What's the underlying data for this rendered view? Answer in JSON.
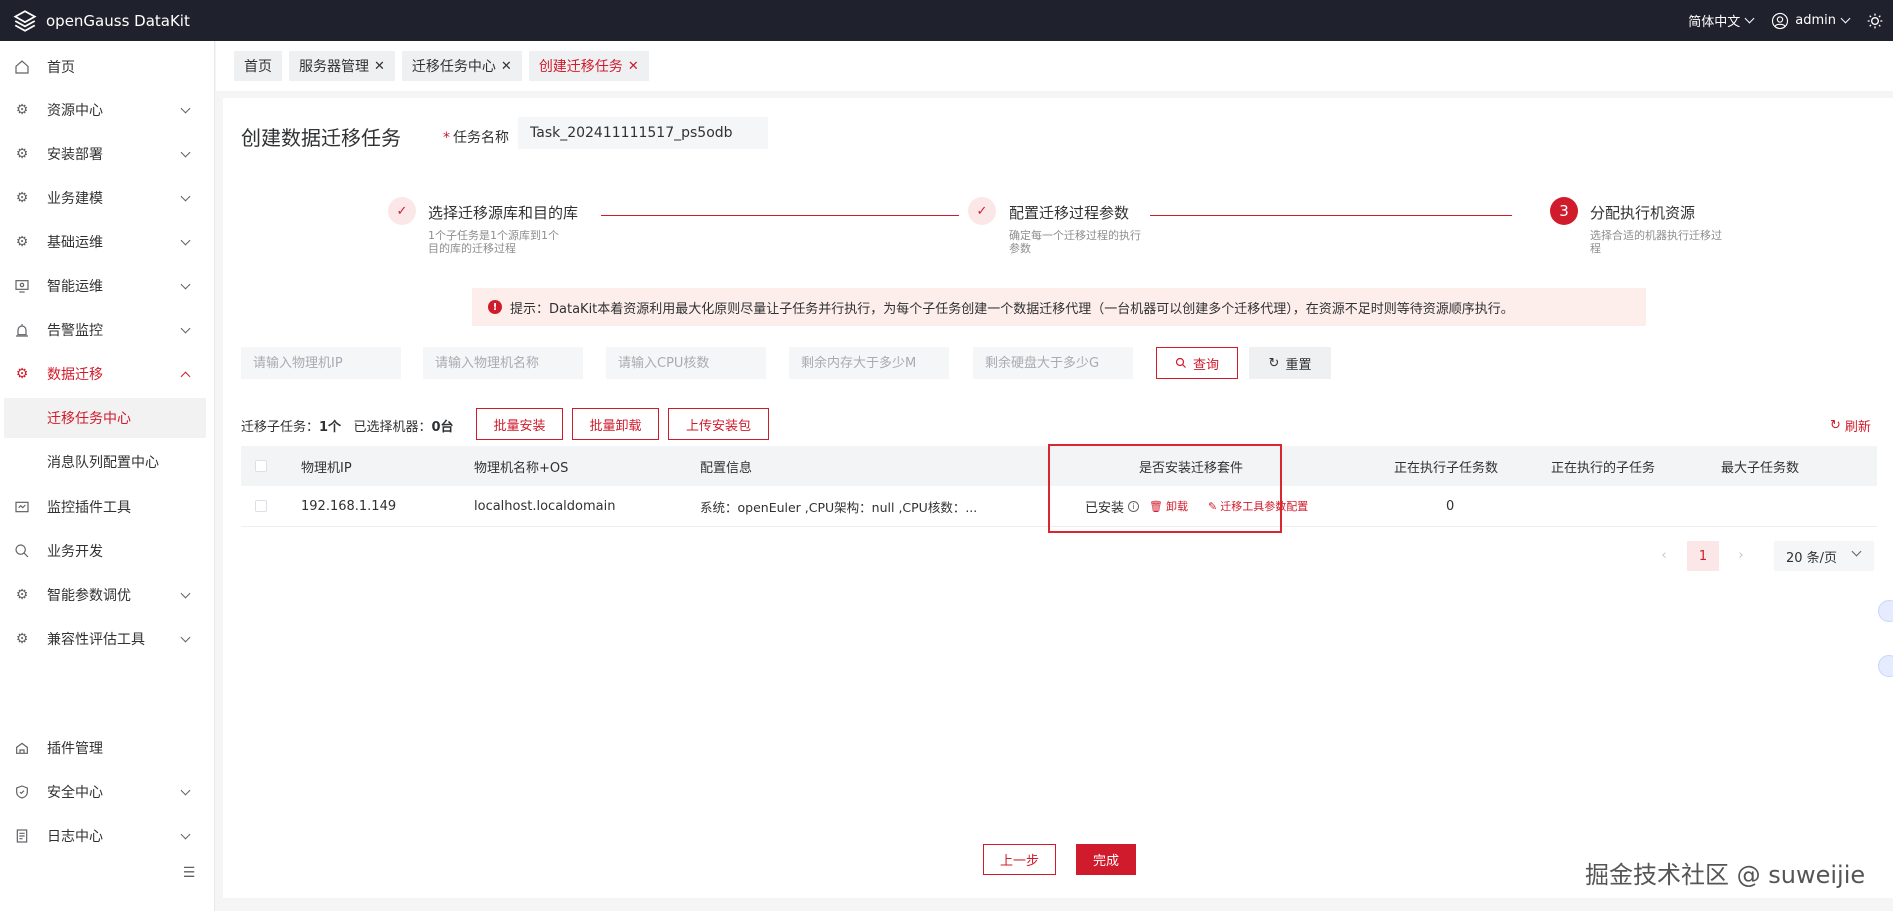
{
  "app": {
    "title": "openGauss DataKit"
  },
  "topbar": {
    "language": "简体中文",
    "user": "admin"
  },
  "sidebar": {
    "items": [
      {
        "label": "首页",
        "icon": "home-icon",
        "expandable": false
      },
      {
        "label": "资源中心",
        "icon": "gear-icon",
        "expandable": true
      },
      {
        "label": "安装部署",
        "icon": "gear-icon",
        "expandable": true
      },
      {
        "label": "业务建模",
        "icon": "gear-icon",
        "expandable": true
      },
      {
        "label": "基础运维",
        "icon": "gear-icon",
        "expandable": true
      },
      {
        "label": "智能运维",
        "icon": "monitor-icon",
        "expandable": true
      },
      {
        "label": "告警监控",
        "icon": "alarm-icon",
        "expandable": true
      },
      {
        "label": "数据迁移",
        "icon": "gear-icon",
        "expandable": true,
        "expanded": true
      },
      {
        "label": "迁移任务中心",
        "sub": true,
        "active": true
      },
      {
        "label": "消息队列配置中心",
        "sub": true
      },
      {
        "label": "监控插件工具",
        "icon": "plugin-monitor-icon",
        "expandable": false
      },
      {
        "label": "业务开发",
        "icon": "search-icon",
        "expandable": false
      },
      {
        "label": "智能参数调优",
        "icon": "gear-icon",
        "expandable": true
      },
      {
        "label": "兼容性评估工具",
        "icon": "gear-icon",
        "expandable": true
      }
    ],
    "bottom_items": [
      {
        "label": "插件管理",
        "icon": "plugin-icon",
        "expandable": false
      },
      {
        "label": "安全中心",
        "icon": "shield-icon",
        "expandable": true
      },
      {
        "label": "日志中心",
        "icon": "log-icon",
        "expandable": true
      }
    ]
  },
  "tabs": [
    {
      "label": "首页",
      "closable": false
    },
    {
      "label": "服务器管理",
      "closable": true
    },
    {
      "label": "迁移任务中心",
      "closable": true
    },
    {
      "label": "创建迁移任务",
      "closable": true,
      "active": true
    }
  ],
  "page": {
    "title": "创建数据迁移任务",
    "task_name_label": "任务名称",
    "task_name_value": "Task_202411111517_ps5odb"
  },
  "steps": [
    {
      "title": "选择迁移源库和目的库",
      "desc": "1个子任务是1个源库到1个目的库的迁移过程",
      "status": "done"
    },
    {
      "title": "配置迁移过程参数",
      "desc": "确定每一个迁移过程的执行参数",
      "status": "done"
    },
    {
      "number": "3",
      "title": "分配执行机资源",
      "desc": "选择合适的机器执行迁移过程",
      "status": "current"
    }
  ],
  "notice": "提示：DataKit本着资源利用最大化原则尽量让子任务并行执行，为每个子任务创建一个数据迁移代理（一台机器可以创建多个迁移代理），在资源不足时则等待资源顺序执行。",
  "filters": {
    "ip_placeholder": "请输入物理机IP",
    "name_placeholder": "请输入物理机名称",
    "cpu_placeholder": "请输入CPU核数",
    "mem_placeholder": "剩余内存大于多少M",
    "disk_placeholder": "剩余硬盘大于多少G",
    "query_label": "查询",
    "reset_label": "重置"
  },
  "toolbar": {
    "subtask_label": "迁移子任务：",
    "subtask_count": "1个",
    "selected_label": "已选择机器：",
    "selected_count": "0台",
    "batch_install": "批量安装",
    "batch_uninstall": "批量卸载",
    "upload_package": "上传安装包",
    "refresh": "刷新"
  },
  "table": {
    "headers": [
      "物理机IP",
      "物理机名称+OS",
      "配置信息",
      "是否安装迁移套件",
      "正在执行子任务数",
      "正在执行的子任务",
      "最大子任务数"
    ],
    "rows": [
      {
        "ip": "192.168.1.149",
        "name": "localhost.localdomain",
        "config": "系统：openEuler ,CPU架构：null ,CPU核数：...",
        "install_status": "已安装",
        "uninstall": "卸载",
        "tool_config": "迁移工具参数配置",
        "running_count": "0",
        "running_tasks": "",
        "max_tasks": ""
      }
    ]
  },
  "pagination": {
    "current": "1",
    "page_size": "20 条/页"
  },
  "footer": {
    "prev_label": "上一步",
    "finish_label": "完成"
  },
  "watermark": "掘金技术社区 @ suweijie",
  "colors": {
    "accent": "#cf1b2b",
    "topbar": "#1f222d",
    "notice_bg": "#fdeeec"
  }
}
